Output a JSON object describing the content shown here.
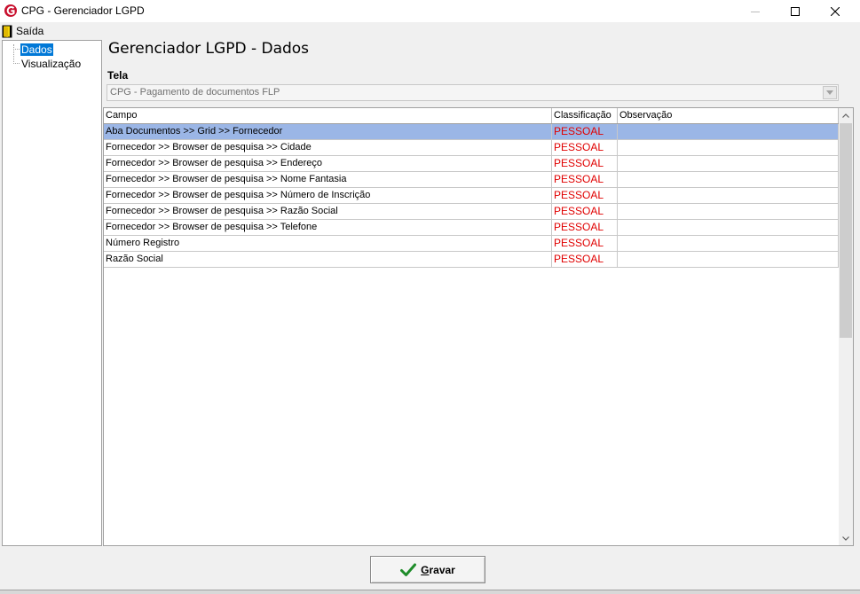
{
  "window": {
    "title": "CPG - Gerenciador LGPD"
  },
  "menu": {
    "exit_label": "Saída"
  },
  "sidebar": {
    "items": [
      {
        "label": "Dados",
        "selected": true
      },
      {
        "label": "Visualização",
        "selected": false
      }
    ]
  },
  "main": {
    "title": "Gerenciador LGPD - Dados",
    "tela_label": "Tela",
    "tela_value": "CPG - Pagamento de documentos FLP"
  },
  "grid": {
    "columns": [
      "Campo",
      "Classificação",
      "Observação"
    ],
    "rows": [
      {
        "campo": "Aba Documentos >> Grid >> Fornecedor",
        "classificacao": "PESSOAL",
        "observacao": ""
      },
      {
        "campo": "Fornecedor >> Browser de pesquisa >> Cidade",
        "classificacao": "PESSOAL",
        "observacao": ""
      },
      {
        "campo": "Fornecedor >> Browser de pesquisa >> Endereço",
        "classificacao": "PESSOAL",
        "observacao": ""
      },
      {
        "campo": "Fornecedor >> Browser de pesquisa >> Nome Fantasia",
        "classificacao": "PESSOAL",
        "observacao": ""
      },
      {
        "campo": "Fornecedor >> Browser de pesquisa >> Número de Inscrição",
        "classificacao": "PESSOAL",
        "observacao": ""
      },
      {
        "campo": "Fornecedor >> Browser de pesquisa >> Razão Social",
        "classificacao": "PESSOAL",
        "observacao": ""
      },
      {
        "campo": "Fornecedor >> Browser de pesquisa >> Telefone",
        "classificacao": "PESSOAL",
        "observacao": ""
      },
      {
        "campo": "Número Registro",
        "classificacao": "PESSOAL",
        "observacao": ""
      },
      {
        "campo": "Razão Social",
        "classificacao": "PESSOAL",
        "observacao": ""
      }
    ]
  },
  "footer": {
    "save_label": "Gravar"
  },
  "colors": {
    "selection": "#9bb6e6",
    "classification": "#e00000",
    "accent": "#0078d7"
  }
}
